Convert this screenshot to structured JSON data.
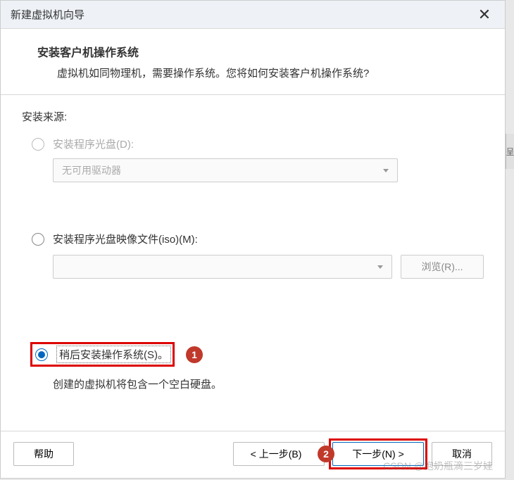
{
  "titlebar": {
    "title": "新建虚拟机向导"
  },
  "header": {
    "title": "安装客户机操作系统",
    "subtitle": "虚拟机如同物理机，需要操作系统。您将如何安装客户机操作系统?"
  },
  "content": {
    "source_label": "安装来源:",
    "option_disc": "安装程序光盘(D):",
    "disc_dropdown": "无可用驱动器",
    "option_iso": "安装程序光盘映像文件(iso)(M):",
    "browse": "浏览(R)...",
    "option_later": "稍后安装操作系统(S)。",
    "later_desc": "创建的虚拟机将包含一个空白硬盘。"
  },
  "annotations": {
    "a1": "1",
    "a2": "2"
  },
  "footer": {
    "help": "帮助",
    "back": "< 上一步(B)",
    "next": "下一步(N) >",
    "cancel": "取消"
  },
  "watermark": "CSDN @抱奶瓶滴三岁娃",
  "misc": {
    "edge_text": "呈"
  }
}
